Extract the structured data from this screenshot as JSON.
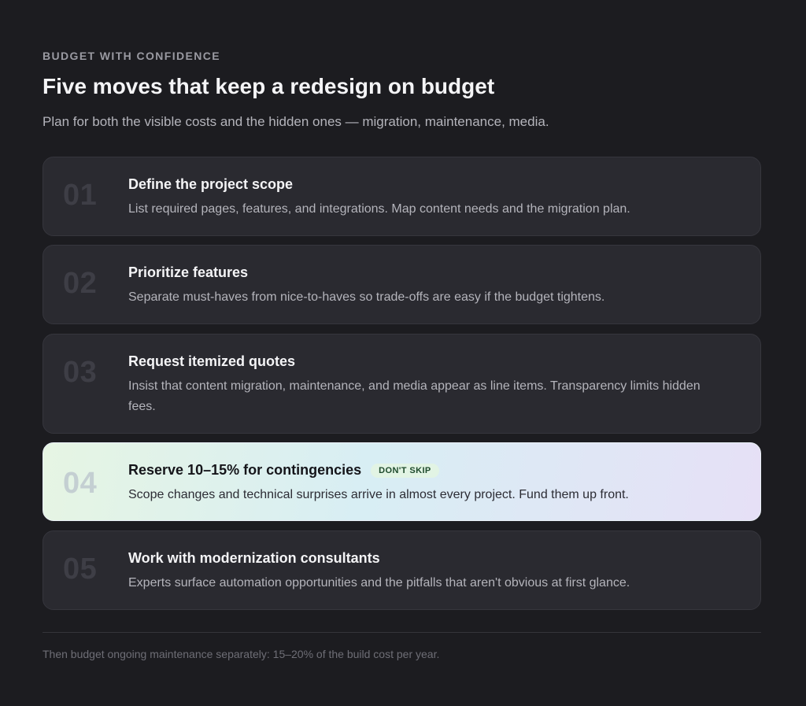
{
  "header": {
    "eyebrow": "BUDGET WITH CONFIDENCE",
    "title": "Five moves that keep a redesign on budget",
    "subtitle": "Plan for both the visible costs and the hidden ones — migration, maintenance, media."
  },
  "steps": [
    {
      "number": "01",
      "title": "Define the project scope",
      "description": "List required pages, features, and integrations. Map content needs and the migration plan."
    },
    {
      "number": "02",
      "title": "Prioritize features",
      "description": "Separate must-haves from nice-to-haves so trade-offs are easy if the budget tightens."
    },
    {
      "number": "03",
      "title": "Request itemized quotes",
      "description": "Insist that content migration, maintenance, and media appear as line items. Transparency limits hidden fees."
    },
    {
      "number": "04",
      "title": "Reserve 10–15% for contingencies",
      "badge": "DON'T SKIP",
      "description": "Scope changes and technical surprises arrive in almost every project. Fund them up front."
    },
    {
      "number": "05",
      "title": "Work with modernization consultants",
      "description": "Experts surface automation opportunities and the pitfalls that aren't obvious at first glance."
    }
  ],
  "footer": {
    "note": "Then budget ongoing maintenance separately: 15–20% of the build cost per year."
  },
  "colors": {
    "background": "#1c1c20",
    "card": "#2a2a30",
    "highlight_start": "#e6f5e3",
    "highlight_end": "#e6e0f6",
    "badge_bg": "#e2f4e4",
    "badge_text": "#1e4a2c"
  }
}
